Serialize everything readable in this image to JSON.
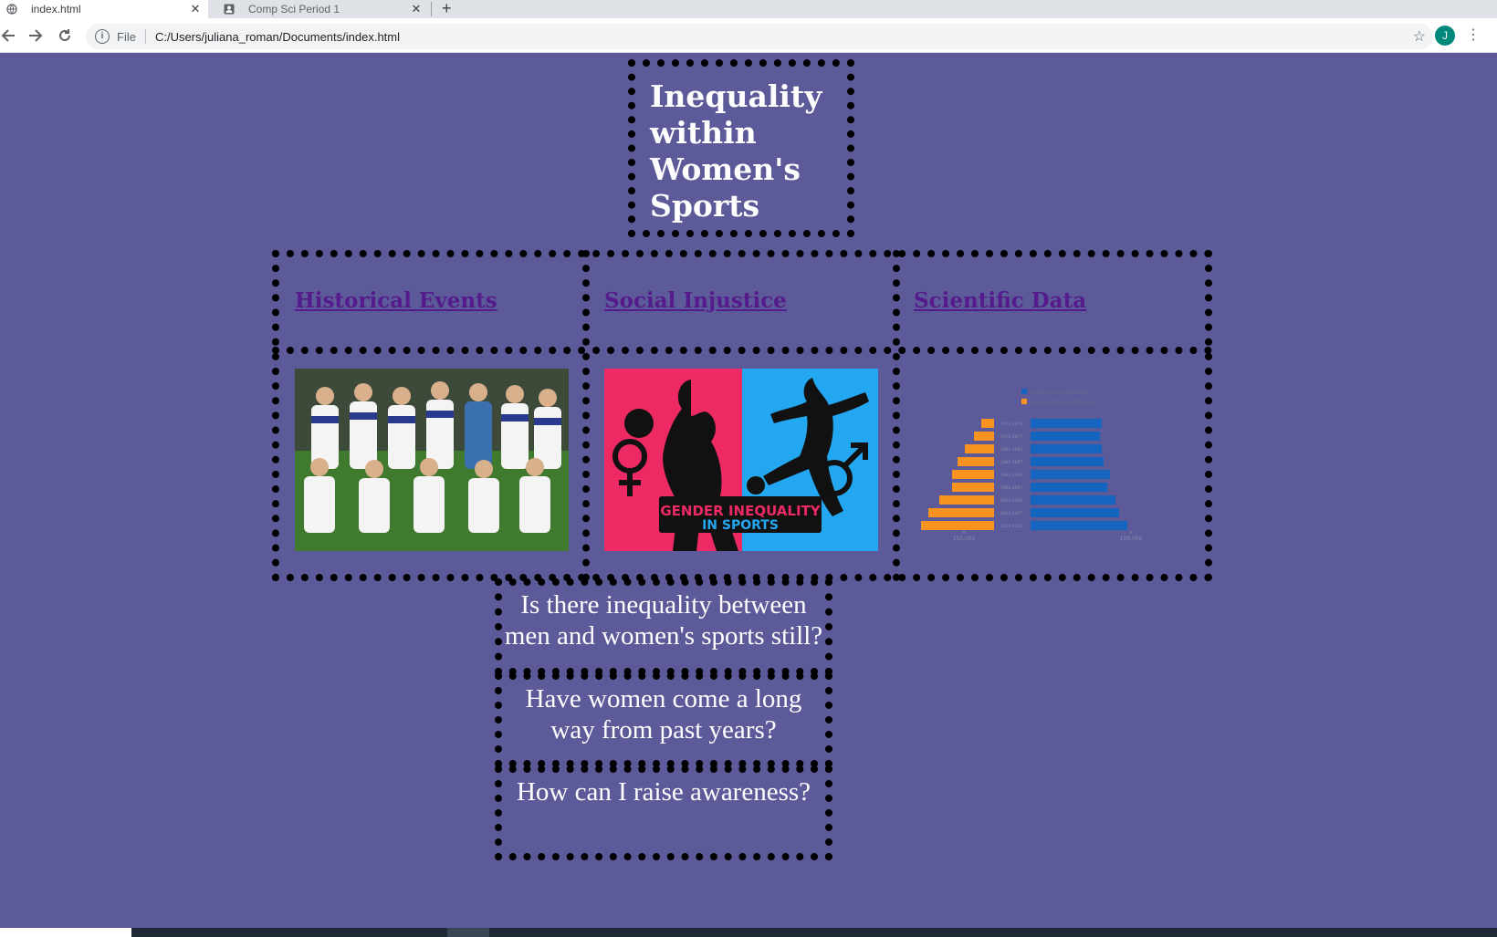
{
  "browser": {
    "tabs": [
      {
        "label": "index.html",
        "active": true
      },
      {
        "label": "Comp Sci Period 1",
        "active": false
      }
    ],
    "new_tab": "+",
    "close_glyph": "✕",
    "address": {
      "scheme": "File",
      "url": "C:/Users/juliana_roman/Documents/index.html"
    },
    "profile_initial": "J"
  },
  "page": {
    "title": "Inequality within Women's Sports",
    "nav": [
      {
        "label": "Historical Events"
      },
      {
        "label": "Social Injustice"
      },
      {
        "label": "Scientific Data"
      }
    ],
    "poster": {
      "line1": "GENDER INEQUALITY",
      "line2": "IN SPORTS"
    },
    "chart": {
      "legend": [
        "College male athletes",
        "College female athletes"
      ],
      "rows": [
        "1971-1972",
        "1976-1977",
        "1981-1982",
        "1986-1987",
        "1991-1992",
        "1996-1997",
        "2001-2002",
        "2006-2007",
        "2010-2011"
      ],
      "axis_left": "150,000",
      "axis_right": "150,000",
      "colors": {
        "male": "#1565c0",
        "female": "#f7931e"
      }
    },
    "questions": [
      "Is there inequality between men and women's sports still?",
      "Have women come a long way from past years?",
      "How can I raise awareness?"
    ]
  },
  "colors": {
    "background": "#5d5a99",
    "border": "#000000",
    "link": "#551a8b",
    "text": "#ffffff"
  }
}
